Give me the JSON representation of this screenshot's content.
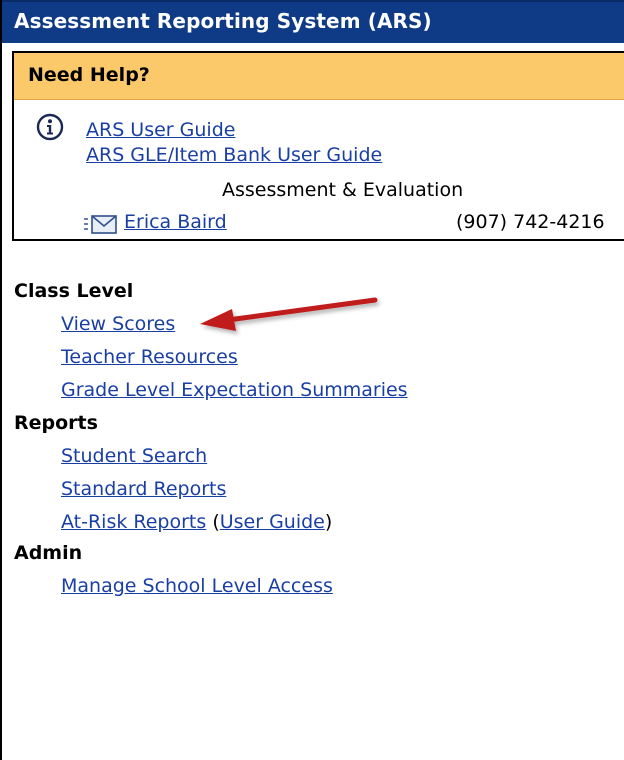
{
  "app": {
    "title": "Assessment Reporting System (ARS)"
  },
  "help": {
    "title": "Need Help?",
    "links": [
      {
        "label": "ARS User Guide"
      },
      {
        "label": "ARS GLE/Item Bank User Guide"
      }
    ],
    "department": "Assessment & Evaluation",
    "contact": {
      "name": "Erica Baird",
      "phone": "(907) 742-4216"
    }
  },
  "nav": {
    "class_level": {
      "heading": "Class Level",
      "links": [
        {
          "label": "View Scores"
        },
        {
          "label": "Teacher Resources"
        },
        {
          "label": "Grade Level Expectation Summaries"
        }
      ]
    },
    "reports": {
      "heading": "Reports",
      "links": [
        {
          "label": "Student Search"
        },
        {
          "label": "Standard Reports"
        }
      ],
      "at_risk": {
        "label": "At-Risk Reports",
        "open_paren": " (",
        "guide_label": "User Guide",
        "close_paren": ")"
      }
    },
    "admin": {
      "heading": "Admin",
      "links": [
        {
          "label": "Manage School Level Access"
        }
      ]
    }
  },
  "colors": {
    "title_bar": "#0f3b86",
    "help_header": "#fbc86a",
    "link": "#1a3fa4",
    "arrow": "#c01a1a"
  },
  "icons": {
    "info": "info-icon",
    "mail": "mail-icon",
    "arrow": "pointer-arrow-icon"
  }
}
